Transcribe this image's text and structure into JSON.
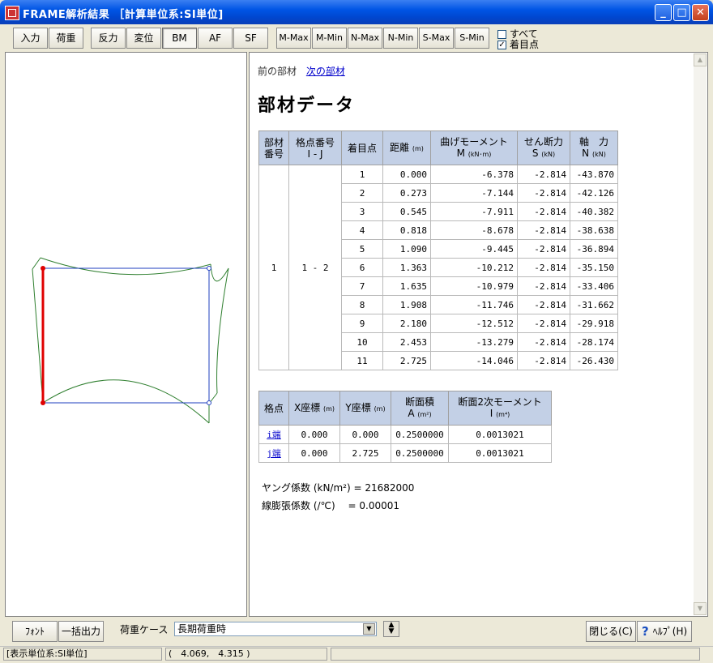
{
  "window": {
    "title": "FRAME解析結果 ［計算単位系:SI単位]",
    "minimize": "_",
    "maximize": "□",
    "close": "✕"
  },
  "toolbar": {
    "buttons": [
      "入力",
      "荷重",
      "反力",
      "変位",
      "BM",
      "AF",
      "SF",
      "M-Max",
      "M-Min",
      "N-Max",
      "N-Min",
      "S-Max",
      "S-Min"
    ],
    "pressed": "BM",
    "checkboxes": [
      {
        "label": "すべて",
        "checked": false
      },
      {
        "label": "着目点",
        "checked": true
      }
    ]
  },
  "content": {
    "nav_prev": "前の部材",
    "nav_next": "次の部材",
    "heading": "部材データ"
  },
  "member_table": {
    "headers": {
      "member_no": [
        "部材",
        "番号"
      ],
      "node_no": [
        "格点番号",
        "I - J"
      ],
      "point": "着目点",
      "distance": "距離",
      "distance_unit": "(m)",
      "moment": "曲げモーメント",
      "moment_sub": "M",
      "moment_unit": "(kN･m)",
      "shear": "せん断力",
      "shear_sub": "S",
      "shear_unit": "(kN)",
      "axial": "軸　力",
      "axial_sub": "N",
      "axial_unit": "(kN)"
    },
    "member_no": "1",
    "node_no": "1 - 2",
    "rows": [
      {
        "pt": "1",
        "dist": "0.000",
        "M": "-6.378",
        "S": "-2.814",
        "N": "-43.870"
      },
      {
        "pt": "2",
        "dist": "0.273",
        "M": "-7.144",
        "S": "-2.814",
        "N": "-42.126"
      },
      {
        "pt": "3",
        "dist": "0.545",
        "M": "-7.911",
        "S": "-2.814",
        "N": "-40.382"
      },
      {
        "pt": "4",
        "dist": "0.818",
        "M": "-8.678",
        "S": "-2.814",
        "N": "-38.638"
      },
      {
        "pt": "5",
        "dist": "1.090",
        "M": "-9.445",
        "S": "-2.814",
        "N": "-36.894"
      },
      {
        "pt": "6",
        "dist": "1.363",
        "M": "-10.212",
        "S": "-2.814",
        "N": "-35.150"
      },
      {
        "pt": "7",
        "dist": "1.635",
        "M": "-10.979",
        "S": "-2.814",
        "N": "-33.406"
      },
      {
        "pt": "8",
        "dist": "1.908",
        "M": "-11.746",
        "S": "-2.814",
        "N": "-31.662"
      },
      {
        "pt": "9",
        "dist": "2.180",
        "M": "-12.512",
        "S": "-2.814",
        "N": "-29.918"
      },
      {
        "pt": "10",
        "dist": "2.453",
        "M": "-13.279",
        "S": "-2.814",
        "N": "-28.174"
      },
      {
        "pt": "11",
        "dist": "2.725",
        "M": "-14.046",
        "S": "-2.814",
        "N": "-26.430"
      }
    ]
  },
  "node_table": {
    "headers": {
      "node": "格点",
      "x": "X座標",
      "x_unit": "(m)",
      "y": "Y座標",
      "y_unit": "(m)",
      "area": "断面積",
      "area_sub": "A",
      "area_unit": "(m²)",
      "inertia": "断面2次モーメント",
      "inertia_sub": "I",
      "inertia_unit": "(m⁴)"
    },
    "rows": [
      {
        "node": "i端",
        "x": "0.000",
        "y": "0.000",
        "A": "0.2500000",
        "I": "0.0013021"
      },
      {
        "node": "j端",
        "x": "0.000",
        "y": "2.725",
        "A": "0.2500000",
        "I": "0.0013021"
      }
    ]
  },
  "properties": {
    "young": "ヤング係数 (kN/m²) = 21682000",
    "thermal": "線膨張係数 (/℃)　 = 0.00001"
  },
  "bottom": {
    "font_button": "ﾌｫﾝﾄ",
    "export_button": "一括出力",
    "load_case_label": "荷重ケース",
    "load_case_value": "長期荷重時",
    "close_button": "閉じる(C)",
    "help_button": "ﾍﾙﾌﾟ(H)"
  },
  "status": {
    "units": "[表示単位系:SI単位]",
    "coords": "(　4.069,　4.315 )"
  },
  "colors": {
    "frame": "#1f3fbf",
    "moment_diagram": "#2f7f2f",
    "selected_member": "#e00000",
    "table_header": "#c3d0e6"
  }
}
